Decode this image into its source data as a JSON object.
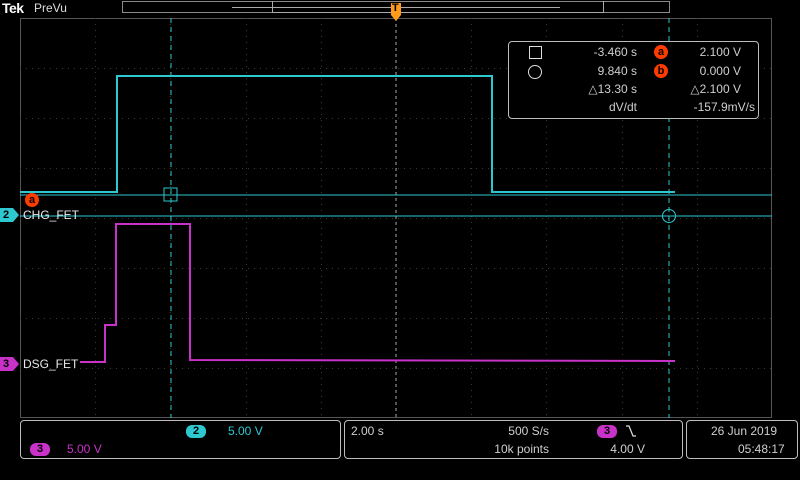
{
  "header": {
    "brand": "Tek",
    "mode": "PreVu"
  },
  "markers": {
    "trigger_position": "T"
  },
  "cursor_readout": {
    "square_time": "-3.460 s",
    "circle_time": "9.840 s",
    "delta_time": "△13.30 s",
    "dv_dt_label": "dV/dt",
    "a_value": "2.100 V",
    "b_value": "0.000 V",
    "delta_v": "△2.100 V",
    "dv_dt_value": "-157.9mV/s",
    "a_label": "a",
    "b_label": "b"
  },
  "channels": [
    {
      "num": "2",
      "label": "CHG_FET",
      "color": "#2ec8d0",
      "scale": "5.00 V"
    },
    {
      "num": "3",
      "label": "DSG_FET",
      "color": "#c832c8",
      "scale": "5.00 V"
    }
  ],
  "ref_marker": {
    "label": "a"
  },
  "timebase": {
    "time_div": "2.00 s",
    "sample_rate": "500 S/s",
    "record_length": "10k points"
  },
  "trigger": {
    "source": "3",
    "slope_icon": "falling-edge",
    "level": "4.00 V"
  },
  "datetime": {
    "date": "26 Jun  2019",
    "time": "05:48:17"
  }
}
